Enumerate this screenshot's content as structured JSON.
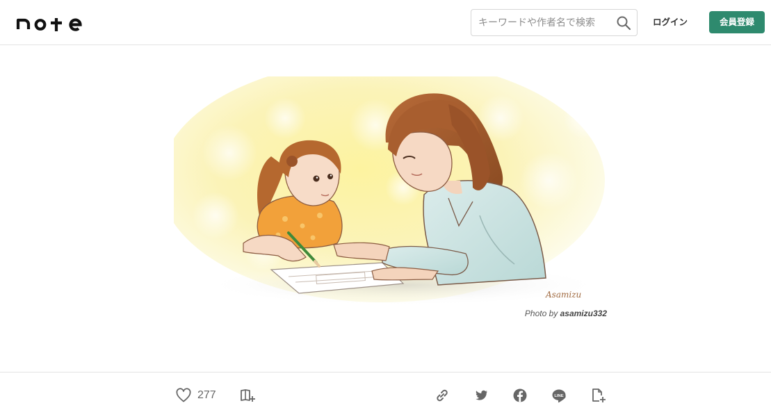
{
  "header": {
    "logo_text": "note",
    "search_placeholder": "キーワードや作者名で検索",
    "login_label": "ログイン",
    "signup_label": "会員登録"
  },
  "hero": {
    "caption_prefix": "Photo by",
    "caption_author": "asamizu332",
    "signature": "Asamizu"
  },
  "actions": {
    "like_count": "277"
  },
  "colors": {
    "brand_green": "#2e8a6e",
    "icon_gray": "#6b6b6b",
    "border": "#e4e4e4"
  },
  "icons": [
    "search-icon",
    "heart-icon",
    "magazine-add-icon",
    "link-icon",
    "twitter-icon",
    "facebook-icon",
    "line-icon",
    "file-add-icon"
  ]
}
